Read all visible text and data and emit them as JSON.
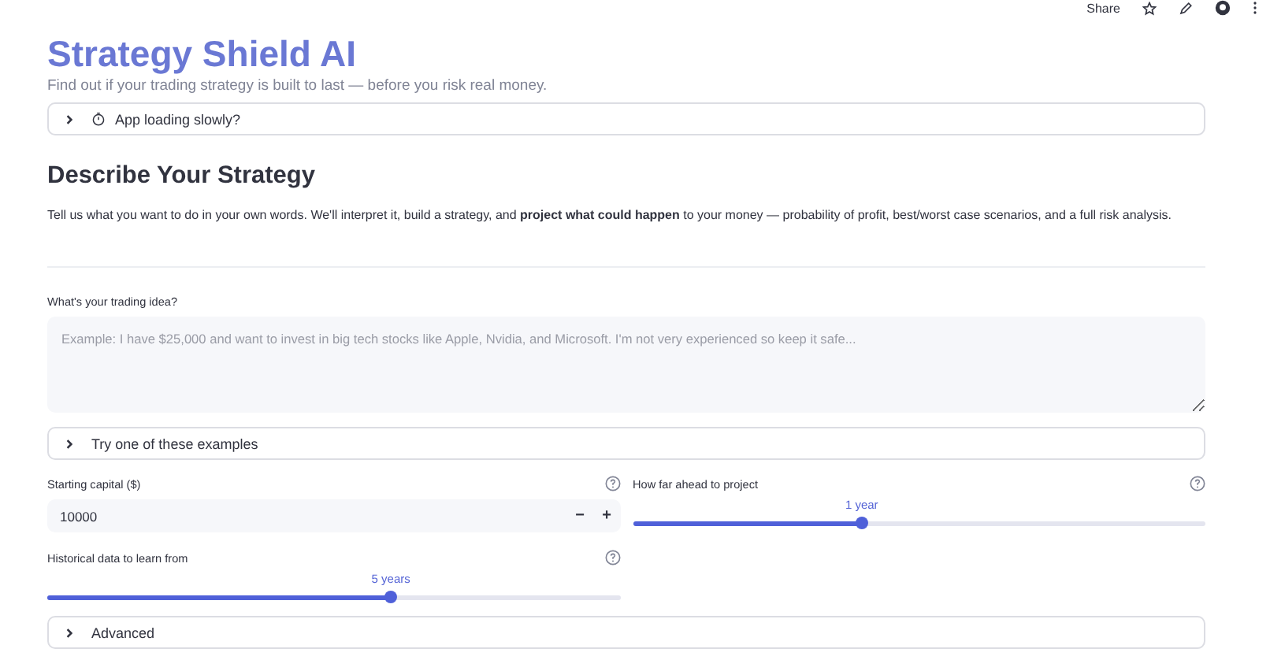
{
  "toolbar": {
    "share_label": "Share"
  },
  "title": "Strategy Shield AI",
  "subtitle": "Find out if your trading strategy is built to last — before you risk real money.",
  "notice_expander": {
    "label": "App loading slowly?",
    "expanded": false
  },
  "section": {
    "heading": "Describe Your Strategy",
    "text": "Tell us what you want to do in your own words. We'll interpret it, build a strategy, and **project what could happen** to your money — probability of profit, best/worst case scenarios, and a full risk analysis."
  },
  "idea_field": {
    "label": "What's your trading idea?",
    "placeholder": "Example: I have $25,000 and want to invest in big tech stocks like Apple, Nvidia, and Microsoft. I'm not very experienced so keep it safe..."
  },
  "examples_expander": {
    "label": "Try one of these examples",
    "expanded": false
  },
  "capital": {
    "label": "Starting capital ($)",
    "value": "10000",
    "minus": "−",
    "plus": "+"
  },
  "horizon": {
    "label": "How far ahead to project",
    "reading": "1 year",
    "level": 0.4
  },
  "history": {
    "label": "Historical data to learn from",
    "reading": "5 years",
    "level": 0.6
  },
  "advanced_expander": {
    "label": "Advanced",
    "expanded": false
  }
}
